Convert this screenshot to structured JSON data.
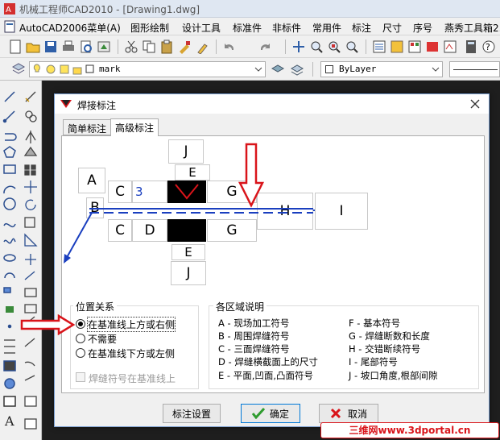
{
  "app": {
    "title": "机械工程师CAD2010 - [Drawing1.dwg]"
  },
  "menu": [
    "AutoCAD2006菜单(A)",
    "图形绘制",
    "设计工具",
    "标准件",
    "非标件",
    "常用件",
    "标注",
    "尺寸",
    "序号",
    "燕秀工具箱2.…"
  ],
  "layer_toolbar": {
    "layer_name": "mark",
    "color_value": "ByLayer"
  },
  "dialog": {
    "title": "焊接标注",
    "tabs": [
      "简单标注",
      "高级标注"
    ],
    "active_tab": 1,
    "diagram": {
      "cells": {
        "J_top": "J",
        "E_top": "E",
        "A": "A",
        "C_top": "C",
        "C_top_value": "3",
        "G_top": "G",
        "B": "B",
        "H": "H",
        "I": "I",
        "C_bot": "C",
        "D": "D",
        "G_bot": "G",
        "E_bot": "E",
        "J_bot": "J"
      }
    },
    "position_group": {
      "title": "位置关系",
      "options": [
        "在基准线上方或右侧",
        "不需要",
        "在基准线下方或左侧"
      ],
      "selected": 0,
      "checkbox_label": "焊缝符号在基准线上",
      "checkbox_checked": false
    },
    "regions_group": {
      "title": "各区域说明",
      "left": [
        "A - 现场加工符号",
        "B - 周围焊缝符号",
        "C - 三面焊缝符号",
        "D - 焊缝横截面上的尺寸",
        "E - 平面,凹面,凸面符号"
      ],
      "right": [
        "F - 基本符号",
        "G - 焊缝断数和长度",
        "H - 交错断续符号",
        "I - 尾部符号",
        "J - 坡口角度,根部间隙"
      ]
    },
    "buttons": {
      "settings": "标注设置",
      "ok": "确定",
      "cancel": "取消"
    }
  },
  "watermark": "三维网www.3dportal.cn",
  "colors": {
    "arrow_red": "#d9141a",
    "accent_blue": "#1a3fbf",
    "dialog_border": "#7a9fd1"
  }
}
